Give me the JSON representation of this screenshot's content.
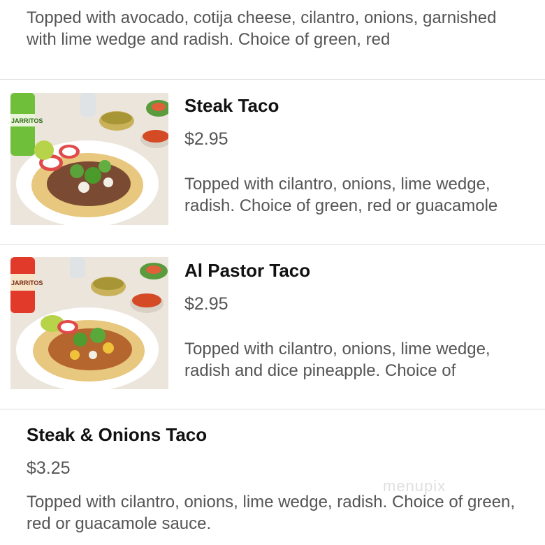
{
  "menu": {
    "top_description": "Topped with avocado, cotija cheese, cilantro, onions, garnished with lime wedge and radish. Choice of green, red",
    "items": [
      {
        "title": "Steak Taco",
        "price": "$2.95",
        "description": "Topped with cilantro, onions, lime wedge, radish. Choice of green, red or guacamole",
        "image_icon": "steak-taco-photo",
        "bottle_label": "JARRITOS"
      },
      {
        "title": "Al Pastor Taco",
        "price": "$2.95",
        "description": "Topped with cilantro, onions, lime wedge, radish and dice pineapple. Choice of",
        "image_icon": "al-pastor-taco-photo",
        "bottle_label": "JARRITOS"
      },
      {
        "title": "Steak & Onions Taco",
        "price": "$3.25",
        "description": "Topped with cilantro, onions, lime wedge, radish. Choice of green, red or guacamole sauce."
      }
    ]
  },
  "watermark": "menupix",
  "colors": {
    "divider": "#dcdcdc",
    "title": "#111111",
    "text": "#555555"
  }
}
